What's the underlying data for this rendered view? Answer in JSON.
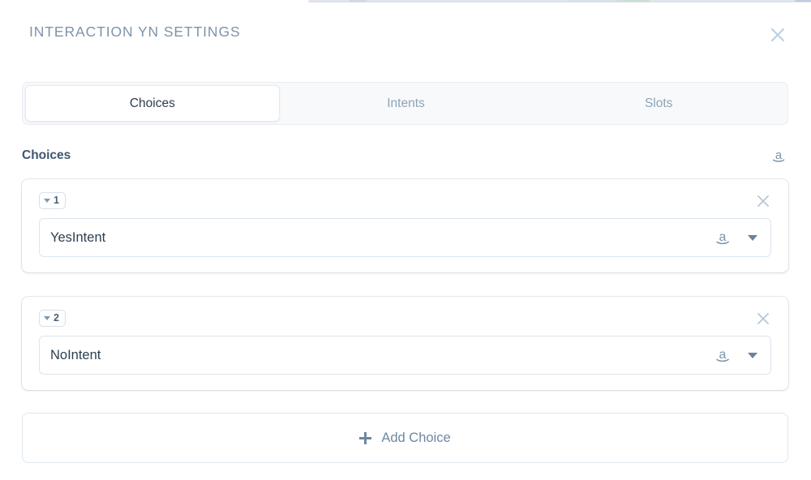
{
  "modal": {
    "title": "INTERACTION YN SETTINGS",
    "close_icon": "close-icon"
  },
  "tabs": [
    {
      "label": "Choices",
      "active": true
    },
    {
      "label": "Intents",
      "active": false
    },
    {
      "label": "Slots",
      "active": false
    }
  ],
  "section": {
    "title": "Choices",
    "icon": "amazon-icon"
  },
  "choices": [
    {
      "index": "1",
      "value": "YesIntent",
      "dropdown_icon": "chevron-down-icon",
      "provider_icon": "amazon-icon",
      "remove_icon": "close-icon"
    },
    {
      "index": "2",
      "value": "NoIntent",
      "dropdown_icon": "chevron-down-icon",
      "provider_icon": "amazon-icon",
      "remove_icon": "close-icon"
    }
  ],
  "add_choice": {
    "label": "Add Choice",
    "icon": "plus-icon"
  },
  "colors": {
    "title": "#7e93ab",
    "text": "#2c3e50",
    "muted": "#8fa3b8",
    "accent": "#6f87a0",
    "border": "#dce5ee"
  }
}
